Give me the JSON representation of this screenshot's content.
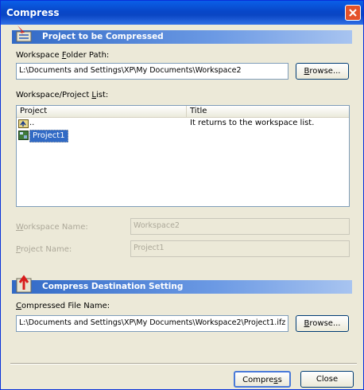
{
  "window": {
    "title": "Compress"
  },
  "section1": {
    "title": "Project to be Compressed"
  },
  "workspace_path": {
    "label_pre": "Workspace ",
    "label_key": "F",
    "label_post": "older Path:",
    "value": "L:\\Documents and Settings\\XP\\My Documents\\Workspace2",
    "browse_pre": "",
    "browse_key": "B",
    "browse_post": "rowse..."
  },
  "project_list": {
    "label_pre": "Workspace/Project ",
    "label_key": "L",
    "label_post": "ist:",
    "columns": [
      "Project",
      "Title"
    ],
    "rows": [
      {
        "name": "..",
        "title": "It returns to the workspace list.",
        "icon": "folder-up-icon"
      },
      {
        "name": "Project1",
        "title": "",
        "icon": "project-icon",
        "selected": true
      }
    ]
  },
  "workspace_name": {
    "label_key": "W",
    "label_post": "orkspace Name:",
    "value": "Workspace2"
  },
  "project_name": {
    "label_key": "P",
    "label_post": "roject Name:",
    "value": "Project1"
  },
  "section2": {
    "title": "Compress Destination Setting"
  },
  "compressed_file": {
    "label_key": "C",
    "label_post": "ompressed File Name:",
    "value": "L:\\Documents and Settings\\XP\\My Documents\\Workspace2\\Project1.ifz",
    "browse_pre": "",
    "browse_key": "B",
    "browse_post": "rowse..."
  },
  "footer": {
    "compress_pre": "Compre",
    "compress_key": "s",
    "compress_post": "s",
    "close": "Close"
  }
}
